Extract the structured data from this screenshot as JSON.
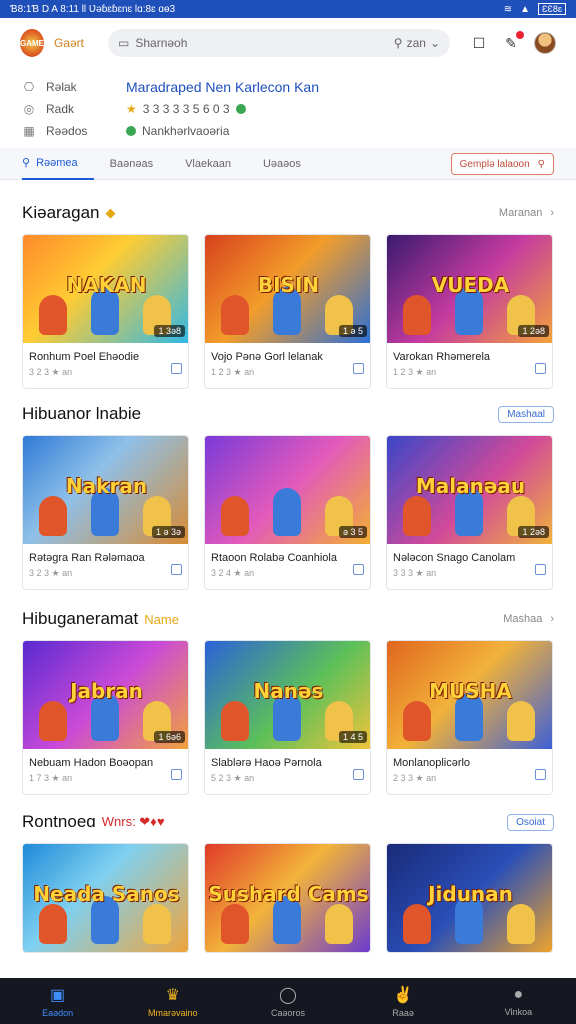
{
  "status": {
    "left": "Ɓ8:1Ɓ  D A 8:11  ll  Ʋəɓɛɓɛnɛ  lɑ:8ɛ ɑɵ3",
    "battery": "ƐƐ8ɛ"
  },
  "header": {
    "logo_text": "GAME",
    "brand": "Gaərt",
    "search_placeholder": "Sharnəoh",
    "search_right": "zan"
  },
  "info": {
    "rows": [
      {
        "icon": "gift-icon",
        "label": "Rəlak",
        "value": "Maradraped Nen Karlecon  Kan"
      },
      {
        "icon": "coin-icon",
        "label": "Radk",
        "value": "3 3 3 3 3 5 6 0 3"
      },
      {
        "icon": "calendar-icon",
        "label": "Rəədos",
        "value": "Nankhərlvaoəria"
      }
    ]
  },
  "tabs": [
    {
      "label": "Rəəmea",
      "active": true
    },
    {
      "label": "Baənəas",
      "active": false
    },
    {
      "label": "Vlaekaan",
      "active": false
    },
    {
      "label": "Uəaəos",
      "active": false
    }
  ],
  "tab_search": "Gemplə lalaoon",
  "sections": [
    {
      "title": "Kiəaragan",
      "tag": "◆",
      "more": "Maranan",
      "cards": [
        {
          "art": "NAKAN",
          "badge": "1 3ə8",
          "name": "Ronhum Poel Ehəodie",
          "meta": "3 2 3 ★ an",
          "bg": "linear-gradient(135deg,#ff8a2a,#ffcc33 40%,#2fb8e8)"
        },
        {
          "art": "BISIN",
          "badge": "1 ə 5",
          "name": "Vojo Pənə Gorl lelanak",
          "meta": "1 2 3 ★ an",
          "bg": "linear-gradient(135deg,#d8401f,#f29d2a 45%,#2a6fd8)"
        },
        {
          "art": "VUEDA",
          "badge": "1 2ə8",
          "name": "Varokan Rhəmerela",
          "meta": "1 2 3 ★ an",
          "bg": "linear-gradient(135deg,#3a1b6e,#c43aa0 50%,#f3a43a)"
        }
      ]
    },
    {
      "title": "Hibuanor lnabie",
      "tag": "",
      "more": "Mashaal",
      "cards": [
        {
          "art": "Nakran",
          "badge": "1 ə 3ə",
          "name": "Rətəgra Ran Rələmaoa",
          "meta": "3 2 3 ★ an",
          "bg": "linear-gradient(135deg,#2f7ad6,#8fc0e8 40%,#d88a30)"
        },
        {
          "art": "",
          "badge": "ə 3 5",
          "name": "Rtaoon Rolabə Coanhiola",
          "meta": "3 2 4 ★ an",
          "bg": "linear-gradient(135deg,#7a3ad8,#e25abc 50%,#f2b030)"
        },
        {
          "art": "Malanəau",
          "badge": "1 2ə8",
          "name": "Nələcon Snago Canolam",
          "meta": "3 3 3 ★ an",
          "bg": "linear-gradient(135deg,#3a46c8,#d24a9a 55%,#f0b43a)"
        }
      ]
    },
    {
      "title": "Hibuganeramat",
      "tag": "Name",
      "more": "Mashaa",
      "cards": [
        {
          "art": "Jabran",
          "badge": "1 6ə6",
          "name": "Nebuam Hadon Boəopan",
          "meta": "1 7 3 ★ an",
          "bg": "linear-gradient(135deg,#5a2ad0,#c94ad8 50%,#f3a33a)"
        },
        {
          "art": "Nanəs",
          "badge": "1 4 5",
          "name": "Slablərə Haoə Pərnola",
          "meta": "5 2 3 ★ an",
          "bg": "linear-gradient(135deg,#2a62d8,#5cc05a 55%,#f2c43a)"
        },
        {
          "art": "MUSHA",
          "badge": "",
          "name": "Monlanoplicərlo",
          "meta": "2 3 3 ★ an",
          "bg": "linear-gradient(135deg,#e0661f,#f2b23a 45%,#3b5fd8)"
        }
      ]
    },
    {
      "title": "Rontnoeɑ",
      "tag": "Wnrs: ❤♦♥",
      "more": "Osoiat",
      "cards": [
        {
          "art": "Neada Sanos",
          "badge": "",
          "name": "",
          "meta": "",
          "bg": "linear-gradient(135deg,#1f8ad8,#7fd0f0 40%,#f0a43a)"
        },
        {
          "art": "Sushard Cams",
          "badge": "",
          "name": "",
          "meta": "",
          "bg": "linear-gradient(135deg,#e03a2a,#f2b43a 45%,#6a3ad0)"
        },
        {
          "art": "Jidunan",
          "badge": "",
          "name": "",
          "meta": "",
          "bg": "linear-gradient(135deg,#1a2a78,#2a4fb8 50%,#f0a42a)"
        }
      ]
    }
  ],
  "nav": [
    {
      "icon": "home-icon",
      "glyph": "▣",
      "label": "Eaədon",
      "state": "active"
    },
    {
      "icon": "trophy-icon",
      "glyph": "♛",
      "label": "Mmarəvaino",
      "state": "gold"
    },
    {
      "icon": "circle-icon",
      "glyph": "◯",
      "label": "Caəoros",
      "state": ""
    },
    {
      "icon": "social-icon",
      "glyph": "✌",
      "label": "Raaə",
      "state": ""
    },
    {
      "icon": "profile-icon",
      "glyph": "●",
      "label": "Vlnkoa",
      "state": ""
    }
  ]
}
